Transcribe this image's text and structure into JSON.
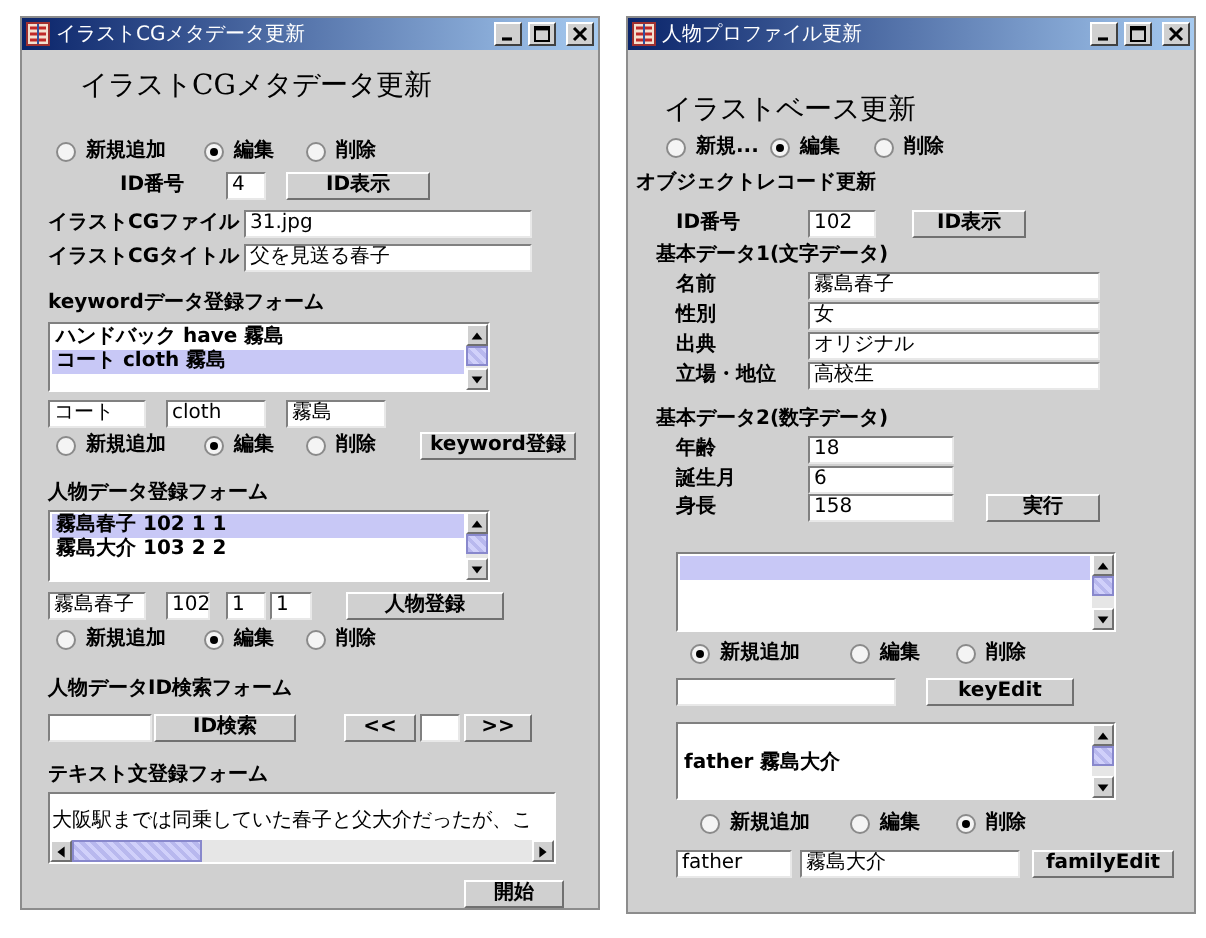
{
  "windows": [
    {
      "title": "イラストCGメタデータ更新",
      "rows": [
        {
          "controls": [
            {
              "kind": "heading",
              "text": "イラストCGメタデータ更新"
            }
          ]
        },
        {
          "controls": [
            {
              "kind": "radios",
              "options": [
                {
                  "label": "新規追加",
                  "selected": false
                },
                {
                  "label": "編集",
                  "selected": true
                },
                {
                  "label": "削除",
                  "selected": false
                }
              ]
            }
          ]
        },
        {
          "controls": [
            {
              "kind": "label",
              "text": "ID番号"
            },
            {
              "kind": "field",
              "value": "4"
            },
            {
              "kind": "button",
              "label": "ID表示"
            }
          ]
        },
        {
          "controls": [
            {
              "kind": "label",
              "text": "イラストCGファイル"
            },
            {
              "kind": "field",
              "value": "31.jpg"
            }
          ]
        },
        {
          "controls": [
            {
              "kind": "label",
              "text": "イラストCGタイトル"
            },
            {
              "kind": "field",
              "value": "父を見送る春子"
            }
          ]
        },
        {
          "controls": [
            {
              "kind": "section",
              "text": "keywordデータ登録フォーム"
            }
          ]
        },
        {
          "controls": [
            {
              "kind": "listbox",
              "items": [
                {
                  "text": "ハンドバック have 霧島",
                  "selected": false
                },
                {
                  "text": "コート cloth 霧島",
                  "selected": true
                }
              ]
            }
          ]
        },
        {
          "controls": [
            {
              "kind": "field",
              "value": "コート"
            },
            {
              "kind": "field",
              "value": "cloth"
            },
            {
              "kind": "field",
              "value": "霧島"
            }
          ]
        },
        {
          "controls": [
            {
              "kind": "radios",
              "options": [
                {
                  "label": "新規追加",
                  "selected": false
                },
                {
                  "label": "編集",
                  "selected": true
                },
                {
                  "label": "削除",
                  "selected": false
                }
              ]
            },
            {
              "kind": "button",
              "label": "keyword登録"
            }
          ]
        },
        {
          "controls": [
            {
              "kind": "section",
              "text": "人物データ登録フォーム"
            }
          ]
        },
        {
          "controls": [
            {
              "kind": "listbox",
              "items": [
                {
                  "text": "霧島春子 102 1 1",
                  "selected": true
                },
                {
                  "text": "霧島大介 103 2 2",
                  "selected": false
                }
              ]
            }
          ]
        },
        {
          "controls": [
            {
              "kind": "field",
              "value": "霧島春子"
            },
            {
              "kind": "field",
              "value": "102"
            },
            {
              "kind": "field",
              "value": "1"
            },
            {
              "kind": "field",
              "value": "1"
            },
            {
              "kind": "button",
              "label": "人物登録"
            }
          ]
        },
        {
          "controls": [
            {
              "kind": "radios",
              "options": [
                {
                  "label": "新規追加",
                  "selected": false
                },
                {
                  "label": "編集",
                  "selected": true
                },
                {
                  "label": "削除",
                  "selected": false
                }
              ]
            }
          ]
        },
        {
          "controls": [
            {
              "kind": "section",
              "text": "人物データID検索フォーム"
            }
          ]
        },
        {
          "controls": [
            {
              "kind": "field"
            },
            {
              "kind": "button",
              "label": "ID検索"
            },
            {
              "kind": "button",
              "label": "<<"
            },
            {
              "kind": "field"
            },
            {
              "kind": "button",
              "label": ">>"
            }
          ]
        },
        {
          "controls": [
            {
              "kind": "section",
              "text": "テキスト文登録フォーム"
            }
          ]
        },
        {
          "controls": [
            {
              "kind": "textarea",
              "value": "大阪駅までは同乗していた春子と父大介だったが、こ"
            }
          ]
        },
        {
          "controls": [
            {
              "kind": "button",
              "label": "開始"
            }
          ]
        }
      ]
    },
    {
      "title": "人物プロファイル更新",
      "rows": [
        {
          "controls": [
            {
              "kind": "heading",
              "text": "イラストベース更新"
            }
          ]
        },
        {
          "controls": [
            {
              "kind": "radios",
              "options": [
                {
                  "label": "新規...",
                  "selected": false
                },
                {
                  "label": "編集",
                  "selected": true
                },
                {
                  "label": "削除",
                  "selected": false
                }
              ]
            }
          ]
        },
        {
          "controls": [
            {
              "kind": "section",
              "text": "オブジェクトレコード更新"
            }
          ]
        },
        {
          "controls": [
            {
              "kind": "label",
              "text": "ID番号"
            },
            {
              "kind": "field",
              "value": "102"
            },
            {
              "kind": "button",
              "label": "ID表示"
            }
          ]
        },
        {
          "controls": [
            {
              "kind": "section",
              "text": "基本データ1(文字データ)"
            }
          ]
        },
        {
          "controls": [
            {
              "kind": "label",
              "text": "名前"
            },
            {
              "kind": "field",
              "value": "霧島春子"
            }
          ]
        },
        {
          "controls": [
            {
              "kind": "label",
              "text": "性別"
            },
            {
              "kind": "field",
              "value": "女"
            }
          ]
        },
        {
          "controls": [
            {
              "kind": "label",
              "text": "出典"
            },
            {
              "kind": "field",
              "value": "オリジナル"
            }
          ]
        },
        {
          "controls": [
            {
              "kind": "label",
              "text": "立場・地位"
            },
            {
              "kind": "field",
              "value": "高校生"
            }
          ]
        },
        {
          "controls": [
            {
              "kind": "section",
              "text": "基本データ2(数字データ)"
            }
          ]
        },
        {
          "controls": [
            {
              "kind": "label",
              "text": "年齢"
            },
            {
              "kind": "field",
              "value": "18"
            }
          ]
        },
        {
          "controls": [
            {
              "kind": "label",
              "text": "誕生月"
            },
            {
              "kind": "field",
              "value": "6"
            }
          ]
        },
        {
          "controls": [
            {
              "kind": "label",
              "text": "身長"
            },
            {
              "kind": "field",
              "value": "158"
            },
            {
              "kind": "button",
              "label": "実行"
            }
          ]
        },
        {
          "controls": [
            {
              "kind": "listbox",
              "items": [
                {
                  "selected": true
                }
              ]
            }
          ]
        },
        {
          "controls": [
            {
              "kind": "radios",
              "options": [
                {
                  "label": "新規追加",
                  "selected": true
                },
                {
                  "label": "編集",
                  "selected": false
                },
                {
                  "label": "削除",
                  "selected": false
                }
              ]
            }
          ]
        },
        {
          "controls": [
            {
              "kind": "field"
            },
            {
              "kind": "button",
              "label": "keyEdit"
            }
          ]
        },
        {
          "controls": [
            {
              "kind": "listbox",
              "items": [
                {
                  "text": "father 霧島大介",
                  "selected": false
                }
              ]
            }
          ]
        },
        {
          "controls": [
            {
              "kind": "radios",
              "options": [
                {
                  "label": "新規追加",
                  "selected": false
                },
                {
                  "label": "編集",
                  "selected": false
                },
                {
                  "label": "削除",
                  "selected": true
                }
              ]
            }
          ]
        },
        {
          "controls": [
            {
              "kind": "field",
              "value": "father"
            },
            {
              "kind": "field",
              "value": "霧島大介"
            },
            {
              "kind": "button",
              "label": "familyEdit"
            }
          ]
        }
      ]
    }
  ]
}
